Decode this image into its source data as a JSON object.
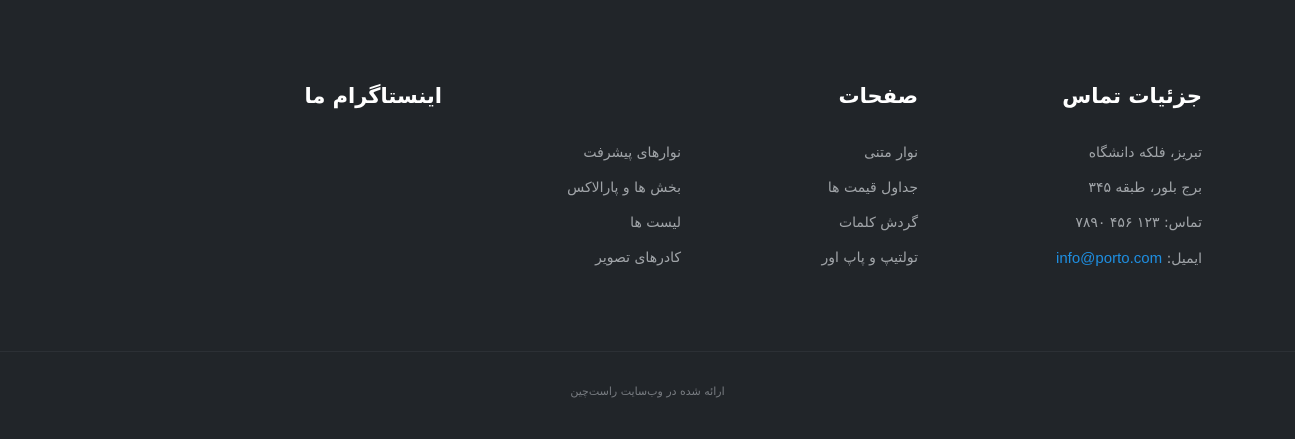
{
  "contact": {
    "title": "جزئیات تماس",
    "address_line1": "تبریز، فلکه دانشگاه",
    "address_line2": "برج بلور، طبقه ۳۴۵",
    "phone_label": "تماس:",
    "phone": "۱۲۳ ۴۵۶ ۷۸۹۰",
    "email_label": "ایمیل:",
    "email": "info@porto.com"
  },
  "pages": {
    "title": "صفحات",
    "col1": [
      "نوار متنی",
      "جداول قیمت ها",
      "گردش کلمات",
      "تولتیپ و پاپ اور"
    ],
    "col2": [
      "نوارهای پیشرفت",
      "بخش ها و پارالاکس",
      "لیست ها",
      "کادرهای تصویر"
    ]
  },
  "instagram": {
    "title": "اینستاگرام ما"
  },
  "copyright": "ارائه شده در وب‌سایت راست‌چین",
  "colors": {
    "background": "#212529",
    "heading": "#ffffff",
    "text": "#a0a4a8",
    "link_accent": "#1e8ee0",
    "divider": "#2c3035"
  }
}
